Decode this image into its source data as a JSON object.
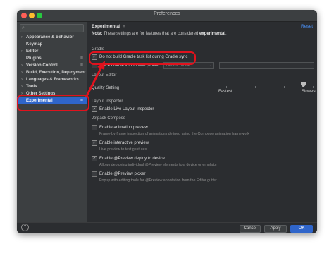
{
  "window": {
    "title": "Preferences"
  },
  "sidebar": {
    "search_placeholder": "",
    "items": [
      {
        "label": "Appearance & Behavior",
        "chevron": "›"
      },
      {
        "label": "Keymap",
        "chevron": ""
      },
      {
        "label": "Editor",
        "chevron": "›"
      },
      {
        "label": "Plugins",
        "chevron": "",
        "config_icon": "≡"
      },
      {
        "label": "Version Control",
        "chevron": "›",
        "config_icon": "≡"
      },
      {
        "label": "Build, Execution, Deployment",
        "chevron": "›"
      },
      {
        "label": "Languages & Frameworks",
        "chevron": "›"
      },
      {
        "label": "Tools",
        "chevron": "›"
      },
      {
        "label": "Other Settings",
        "chevron": "›"
      },
      {
        "label": "Experimental",
        "chevron": "",
        "config_icon": "≡",
        "selected": true
      }
    ]
  },
  "main": {
    "header": "Experimental",
    "header_icon": "≡",
    "reset": "Reset",
    "note_prefix": "Note:",
    "note_body": " These settings are for features that are considered ",
    "note_bold": "experimental",
    "note_suffix": ".",
    "gradle": {
      "section": "Gradle",
      "do_not_build": {
        "label": "Do not build Gradle task list during Gradle sync",
        "checked": true
      },
      "trace_import": {
        "label": "Trace Gradle import with profile:",
        "checked": false
      },
      "profile_combo": "Default profile"
    },
    "layout_editor": {
      "section": "Layout Editor",
      "quality_label": "Quality Setting",
      "fastest": "Fastest",
      "slowest": "Slowest",
      "quality_fraction": 0.86
    },
    "layout_inspector": {
      "section": "Layout Inspector",
      "live": {
        "label": "Enable Live Layout Inspector",
        "checked": true
      }
    },
    "jetpack": {
      "section": "Jetpack Compose",
      "items": [
        {
          "label": "Enable animation preview",
          "checked": false,
          "desc": "Frame-by-frame inspection of animations defined using the Compose animation framework"
        },
        {
          "label": "Enable interactive preview",
          "checked": true,
          "desc": "Live preview to test gestures"
        },
        {
          "label": "Enable @Preview deploy to device",
          "checked": true,
          "desc": "Allows deploying individual @Preview elements to a device or emulator"
        },
        {
          "label": "Enable @Preview picker",
          "checked": false,
          "desc": "Popup with editing tools for @Preview annotation from the Editor gutter"
        }
      ]
    }
  },
  "footer": {
    "help": "?",
    "cancel": "Cancel",
    "apply": "Apply",
    "ok": "OK"
  },
  "colors": {
    "accent": "#2f65ca",
    "highlight": "#e0121d",
    "link": "#4a8ef0"
  }
}
